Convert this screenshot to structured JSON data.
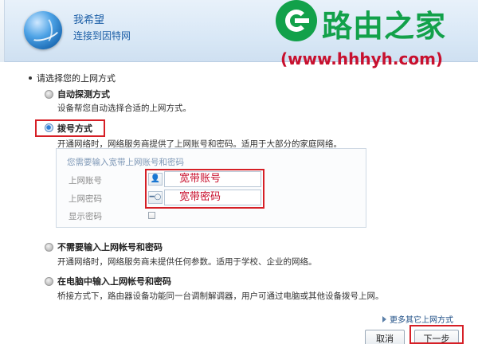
{
  "header": {
    "title": "我希望",
    "subtitle": "连接到因特网"
  },
  "watermark": {
    "brand": "路由之家",
    "url": "(www.hhhyh.com)"
  },
  "main": {
    "section_title": "请选择您的上网方式",
    "options": [
      {
        "label": "自动探测方式",
        "desc": "设备帮您自动选择合适的上网方式。",
        "selected": false
      },
      {
        "label": "拨号方式",
        "desc": "开通网络时，网络服务商提供了上网账号和密码。适用于大部分的家庭网络。",
        "selected": true
      },
      {
        "label": "不需要输入上网帐号和密码",
        "desc": "开通网络时，网络服务商未提供任何参数。适用于学校、企业的网络。",
        "selected": false
      },
      {
        "label": "在电脑中输入上网帐号和密码",
        "desc": "桥接方式下，路由器设备功能同一台调制解调器，用户可通过电脑或其他设备拨号上网。",
        "selected": false
      }
    ],
    "dial_panel": {
      "caption": "您需要输入宽带上网账号和密码",
      "account_label": "上网账号",
      "account_value": "宽带账号",
      "password_label": "上网密码",
      "password_value": "宽带密码",
      "show_password_label": "显示密码"
    }
  },
  "footer": {
    "more_link": "更多其它上网方式",
    "cancel_label": "取消",
    "next_label": "下一步"
  }
}
